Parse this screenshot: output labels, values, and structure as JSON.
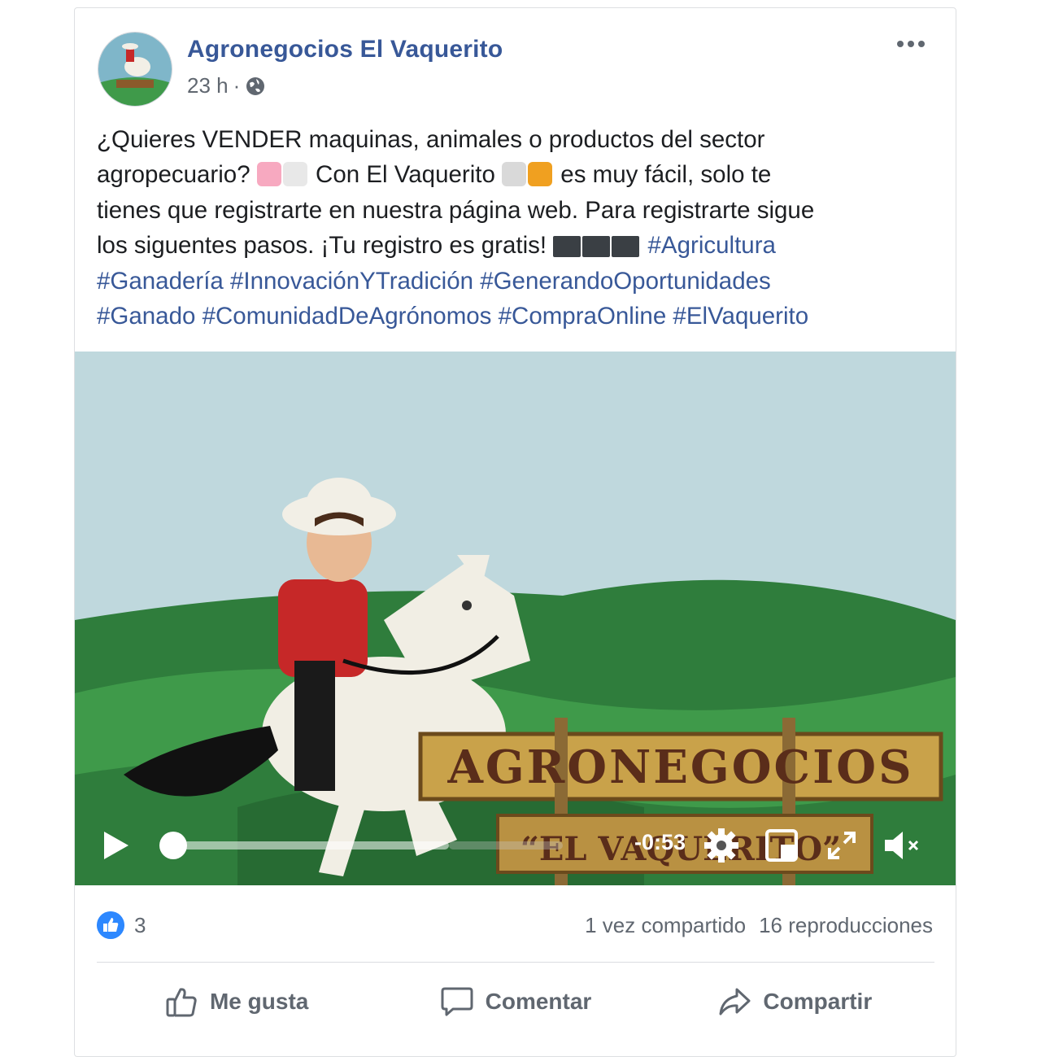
{
  "post": {
    "page_name": "Agronegocios El Vaquerito",
    "time": "23 h",
    "separator": "·",
    "text_line1": "¿Quieres VENDER maquinas, animales o productos del sector",
    "text_line2a": "agropecuario?",
    "text_line2b": "Con El Vaquerito",
    "text_line2c": "es muy fácil, solo te",
    "text_line3": "tienes que registrarte en nuestra página web. Para registrarte sigue",
    "text_line4": "los siguentes pasos. ¡Tu registro es gratis!",
    "hashtags_line4": "#Agricultura",
    "hashtags_line5": "#Ganadería #InnovaciónYTradición #GenerandoOportunidades",
    "hashtags_line6": "#Ganado #ComunidadDeAgrónomos #CompraOnline #ElVaquerito"
  },
  "video": {
    "sign_title": "AGRONEGOCIOS",
    "sign_subtitle": "“EL VAQUERITO”",
    "remaining_time": "-0:53",
    "progress_fraction": 0.0
  },
  "stats": {
    "like_count": "3",
    "shares": "1 vez compartido",
    "views": "16 reproducciones"
  },
  "actions": {
    "like": "Me gusta",
    "comment": "Comentar",
    "share": "Compartir"
  },
  "colors": {
    "link": "#385898",
    "like_blue": "#2d88ff",
    "sky": "#bfd8dd",
    "hill_dark": "#2f7d3c",
    "hill_light": "#3f9a4a"
  },
  "icons": [
    "globe-icon",
    "more-options-icon",
    "pig-emoji",
    "cow-emoji",
    "cows-emoji",
    "tractor-emoji",
    "computer-emoji",
    "play-icon",
    "gear-icon",
    "miniplayer-icon",
    "fullscreen-icon",
    "mute-icon",
    "like-badge-icon",
    "thumbs-up-icon",
    "comment-icon",
    "share-icon"
  ]
}
